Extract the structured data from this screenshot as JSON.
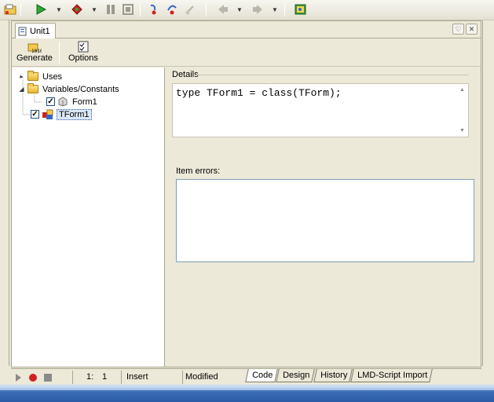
{
  "toolbar": {
    "buttons": [
      "open-icon",
      "run-icon",
      "run-dropdown",
      "debug-run-icon",
      "debug-dropdown",
      "pause-icon",
      "stop-icon",
      "step-into-icon",
      "step-over-icon",
      "run-to-cursor-icon",
      "back-icon",
      "back-dropdown",
      "forward-icon",
      "forward-dropdown",
      "help-book-icon"
    ]
  },
  "editor": {
    "tab_label": "Unit1",
    "design_toolbar": {
      "generate_label": "Generate",
      "options_label": "Options"
    },
    "tree": {
      "items": [
        {
          "label": "Uses",
          "icon": "folder-icon"
        },
        {
          "label": "Variables/Constants",
          "icon": "folder-icon"
        },
        {
          "label": "Form1",
          "icon": "variable-icon",
          "checked": true
        },
        {
          "label": "TForm1",
          "icon": "class-icon",
          "checked": true,
          "selected": true
        }
      ]
    },
    "details": {
      "header": "Details",
      "code": "type TForm1 = class(TForm);",
      "errors_label": "Item errors:",
      "errors_text": ""
    }
  },
  "statusbar": {
    "line": "1:",
    "col": "1",
    "mode": "Insert",
    "state": "Modified",
    "tabs": [
      "Code",
      "Design",
      "History",
      "LMD-Script Import"
    ]
  },
  "colors": {
    "run_green": "#2fa82f",
    "debug_red": "#d02020",
    "selection_blue": "#dbe8f7",
    "taskbar_blue": "#3b6db3"
  }
}
